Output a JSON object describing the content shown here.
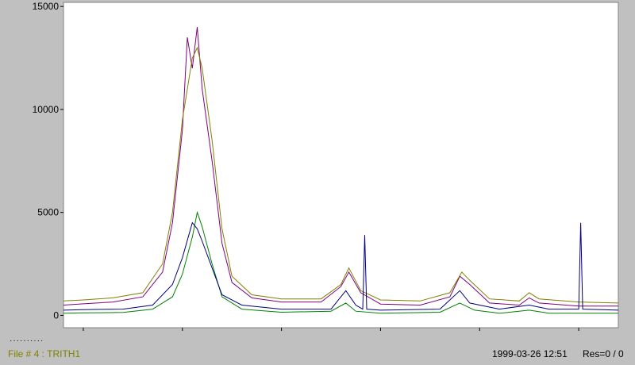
{
  "chart_data": {
    "type": "line",
    "title": "",
    "xlabel": "",
    "ylabel": "",
    "xlim": [
      484.8,
      490.4
    ],
    "ylim": [
      -600,
      15200
    ],
    "xticks": [
      485,
      486,
      487,
      488,
      489,
      490
    ],
    "yticks": [
      0,
      5000,
      10000,
      15000
    ],
    "grid": false,
    "series": [
      {
        "color": "#800080",
        "points": [
          [
            484.8,
            500
          ],
          [
            485.0,
            560
          ],
          [
            485.3,
            650
          ],
          [
            485.6,
            900
          ],
          [
            485.8,
            2100
          ],
          [
            485.9,
            4500
          ],
          [
            486.0,
            9000
          ],
          [
            486.05,
            13500
          ],
          [
            486.1,
            12000
          ],
          [
            486.15,
            14000
          ],
          [
            486.2,
            11000
          ],
          [
            486.3,
            7500
          ],
          [
            486.4,
            3500
          ],
          [
            486.5,
            1600
          ],
          [
            486.7,
            850
          ],
          [
            487.0,
            650
          ],
          [
            487.4,
            650
          ],
          [
            487.6,
            1400
          ],
          [
            487.68,
            2100
          ],
          [
            487.8,
            1100
          ],
          [
            488.0,
            550
          ],
          [
            488.4,
            500
          ],
          [
            488.7,
            900
          ],
          [
            488.8,
            1900
          ],
          [
            488.9,
            1500
          ],
          [
            489.1,
            600
          ],
          [
            489.4,
            500
          ],
          [
            489.5,
            850
          ],
          [
            489.6,
            600
          ],
          [
            490.0,
            450
          ],
          [
            490.4,
            450
          ]
        ]
      },
      {
        "color": "#808000",
        "points": [
          [
            484.8,
            700
          ],
          [
            485.0,
            750
          ],
          [
            485.3,
            850
          ],
          [
            485.6,
            1100
          ],
          [
            485.8,
            2500
          ],
          [
            485.9,
            5000
          ],
          [
            486.0,
            9500
          ],
          [
            486.1,
            12500
          ],
          [
            486.15,
            13000
          ],
          [
            486.2,
            12000
          ],
          [
            486.3,
            8500
          ],
          [
            486.4,
            4200
          ],
          [
            486.5,
            1900
          ],
          [
            486.7,
            1000
          ],
          [
            487.0,
            800
          ],
          [
            487.4,
            800
          ],
          [
            487.6,
            1500
          ],
          [
            487.68,
            2300
          ],
          [
            487.8,
            1200
          ],
          [
            488.0,
            750
          ],
          [
            488.4,
            700
          ],
          [
            488.7,
            1100
          ],
          [
            488.82,
            2100
          ],
          [
            488.9,
            1700
          ],
          [
            489.1,
            800
          ],
          [
            489.4,
            700
          ],
          [
            489.5,
            1100
          ],
          [
            489.6,
            800
          ],
          [
            490.0,
            650
          ],
          [
            490.4,
            600
          ]
        ]
      },
      {
        "color": "#008000",
        "points": [
          [
            484.8,
            100
          ],
          [
            485.0,
            120
          ],
          [
            485.4,
            140
          ],
          [
            485.7,
            300
          ],
          [
            485.9,
            900
          ],
          [
            486.0,
            2000
          ],
          [
            486.1,
            3800
          ],
          [
            486.15,
            5000
          ],
          [
            486.2,
            4300
          ],
          [
            486.3,
            2500
          ],
          [
            486.4,
            900
          ],
          [
            486.6,
            300
          ],
          [
            487.0,
            150
          ],
          [
            487.5,
            200
          ],
          [
            487.65,
            600
          ],
          [
            487.75,
            200
          ],
          [
            488.0,
            100
          ],
          [
            488.6,
            150
          ],
          [
            488.8,
            600
          ],
          [
            488.95,
            250
          ],
          [
            489.2,
            100
          ],
          [
            489.5,
            250
          ],
          [
            489.7,
            100
          ],
          [
            490.4,
            100
          ]
        ]
      },
      {
        "color": "#000080",
        "points": [
          [
            484.8,
            250
          ],
          [
            485.0,
            280
          ],
          [
            485.4,
            300
          ],
          [
            485.7,
            500
          ],
          [
            485.9,
            1500
          ],
          [
            486.0,
            2800
          ],
          [
            486.1,
            4500
          ],
          [
            486.15,
            4200
          ],
          [
            486.2,
            3600
          ],
          [
            486.3,
            2300
          ],
          [
            486.4,
            1000
          ],
          [
            486.6,
            500
          ],
          [
            487.0,
            300
          ],
          [
            487.5,
            300
          ],
          [
            487.65,
            1200
          ],
          [
            487.75,
            500
          ],
          [
            487.82,
            300
          ],
          [
            487.84,
            3900
          ],
          [
            487.86,
            300
          ],
          [
            488.0,
            250
          ],
          [
            488.6,
            300
          ],
          [
            488.8,
            1200
          ],
          [
            488.9,
            600
          ],
          [
            489.2,
            300
          ],
          [
            489.5,
            500
          ],
          [
            489.7,
            300
          ],
          [
            490.0,
            300
          ],
          [
            490.02,
            4500
          ],
          [
            490.04,
            300
          ],
          [
            490.4,
            250
          ]
        ]
      }
    ]
  },
  "legend_marker": "··········",
  "status_bar": {
    "file_label": "File # 4 : TRITH1",
    "timestamp": "1999-03-26  12:51",
    "resolution": "Res=0 / 0"
  }
}
